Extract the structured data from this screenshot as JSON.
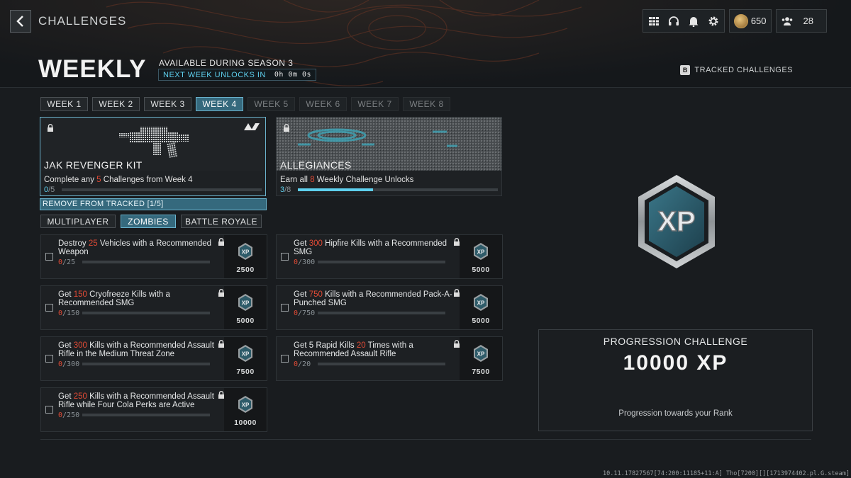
{
  "header": {
    "title": "CHALLENGES",
    "section": "WEEKLY",
    "season": "AVAILABLE DURING SEASON 3",
    "next_unlock_label": "NEXT WEEK UNLOCKS IN",
    "next_unlock_time": "0h 0m 0s",
    "currency": "650",
    "party_count": "28",
    "tracked_key": "B",
    "tracked_label": "TRACKED CHALLENGES"
  },
  "week_tabs": [
    {
      "label": "WEEK 1",
      "state": "unlocked"
    },
    {
      "label": "WEEK 2",
      "state": "unlocked"
    },
    {
      "label": "WEEK 3",
      "state": "unlocked"
    },
    {
      "label": "WEEK 4",
      "state": "active"
    },
    {
      "label": "WEEK 5",
      "state": "locked"
    },
    {
      "label": "WEEK 6",
      "state": "locked"
    },
    {
      "label": "WEEK 7",
      "state": "locked"
    },
    {
      "label": "WEEK 8",
      "state": "locked"
    }
  ],
  "rewards": [
    {
      "title": "JAK REVENGER KIT",
      "desc_pre": "Complete any ",
      "desc_num": "5",
      "desc_post": " Challenges from Week 4",
      "current": "0",
      "total": "/5",
      "progress": 0.0
    },
    {
      "title": "ALLEGIANCES",
      "desc_pre": "Earn all ",
      "desc_num": "8",
      "desc_post": " Weekly Challenge Unlocks",
      "current": "3",
      "total": "/8",
      "progress": 0.375
    }
  ],
  "remove_tracked": "REMOVE FROM TRACKED [1/5]",
  "mode_tabs": [
    {
      "label": "MULTIPLAYER",
      "active": false
    },
    {
      "label": "ZOMBIES",
      "active": true
    },
    {
      "label": "BATTLE ROYALE",
      "active": false
    }
  ],
  "challenges": [
    {
      "pre": "Destroy ",
      "num": "25",
      "post": " Vehicles with a Recommended Weapon",
      "current": "0",
      "total": "/25",
      "xp": "2500"
    },
    {
      "pre": "Get ",
      "num": "300",
      "post": " Hipfire Kills with a Recommended SMG",
      "current": "0",
      "total": "/300",
      "xp": "5000"
    },
    {
      "pre": "Get ",
      "num": "150",
      "post": " Cryofreeze Kills with a Recommended SMG",
      "current": "0",
      "total": "/150",
      "xp": "5000"
    },
    {
      "pre": "Get ",
      "num": "750",
      "post": " Kills with a Recommended Pack-A-Punched SMG",
      "current": "0",
      "total": "/750",
      "xp": "5000"
    },
    {
      "pre": "Get ",
      "num": "300",
      "post": " Kills with a Recommended Assault Rifle in the Medium Threat Zone",
      "current": "0",
      "total": "/300",
      "xp": "7500"
    },
    {
      "pre": "Get 5 Rapid Kills ",
      "num": "20",
      "post": " Times with a Recommended Assault Rifle",
      "current": "0",
      "total": "/20",
      "xp": "7500"
    },
    {
      "pre": "Get ",
      "num": "250",
      "post": " Kills with a Recommended Assault Rifle while Four Cola Perks are Active",
      "current": "0",
      "total": "/250",
      "xp": "10000"
    }
  ],
  "progression": {
    "title": "PROGRESSION CHALLENGE",
    "xp": "10000 XP",
    "desc": "Progression towards your Rank",
    "badge_text": "XP"
  },
  "icons": {
    "back": "chevron-left-icon",
    "grid": "grid-icon",
    "headset": "headset-icon",
    "bell": "bell-icon",
    "gear": "gear-icon",
    "coin": "cod-points-icon",
    "party": "party-icon",
    "lock": "lock-icon"
  },
  "colors": {
    "accent": "#5ed0ee",
    "active_tab": "#35697d",
    "highlight_number": "#e04a35"
  },
  "build_string": "10.11.17827567[74:200:11185+11:A] Tho[7200][][1713974402.pl.G.steam]"
}
